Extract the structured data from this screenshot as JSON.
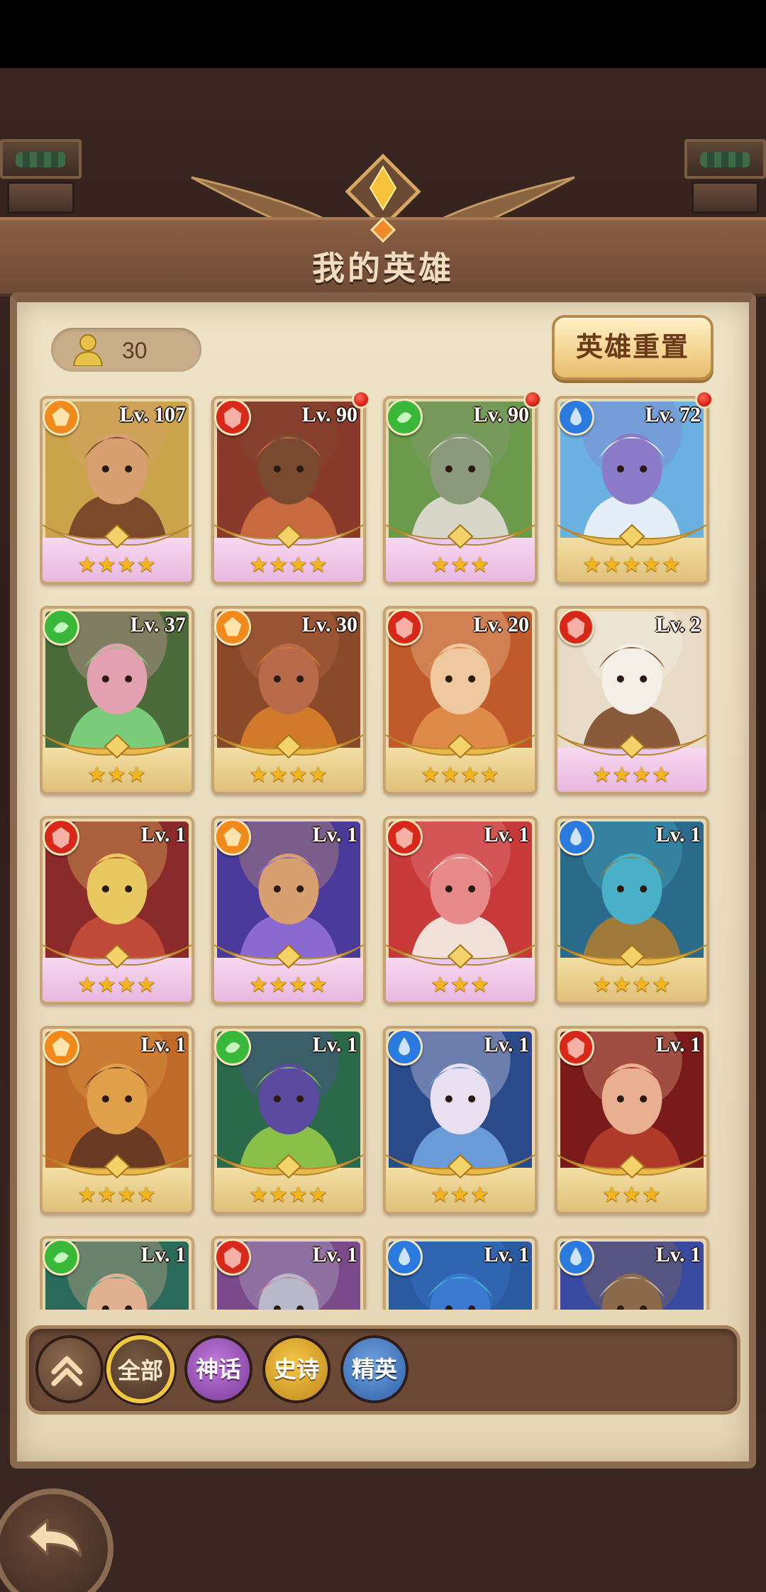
{
  "header": {
    "title": "我的英雄"
  },
  "hero_count": "30",
  "reset_button": "英雄重置",
  "heroes": [
    {
      "level": "Lv. 107",
      "element": "fire-gem",
      "stars": "★★★★",
      "tier": "mythic",
      "alert": false,
      "palette": [
        "#caa34a",
        "#7c4a2a",
        "#d8a070"
      ]
    },
    {
      "level": "Lv. 90",
      "element": "red-gem",
      "stars": "★★★★",
      "tier": "mythic",
      "alert": true,
      "palette": [
        "#8a3a2a",
        "#c86a40",
        "#7a4a30"
      ]
    },
    {
      "level": "Lv. 90",
      "element": "green-gem",
      "stars": "★★★",
      "tier": "mythic",
      "alert": true,
      "palette": [
        "#6a9a4a",
        "#d8d6c8",
        "#8a9a7a"
      ]
    },
    {
      "level": "Lv. 72",
      "element": "water-gem",
      "stars": "★★★★★",
      "tier": "gold",
      "alert": true,
      "palette": [
        "#6ab0e0",
        "#e4eef8",
        "#8a7ac8"
      ]
    },
    {
      "level": "Lv. 37",
      "element": "green-gem",
      "stars": "★★★",
      "tier": "gold",
      "alert": false,
      "palette": [
        "#4a6a3a",
        "#7acc7a",
        "#e2a0b0"
      ]
    },
    {
      "level": "Lv. 30",
      "element": "fire-gem",
      "stars": "★★★★",
      "tier": "gold",
      "alert": false,
      "palette": [
        "#8a4a2a",
        "#d07a2a",
        "#b86a4a"
      ]
    },
    {
      "level": "Lv. 20",
      "element": "red-gem",
      "stars": "★★★★",
      "tier": "gold",
      "alert": false,
      "palette": [
        "#c05a2a",
        "#e08a4a",
        "#f0c8a0"
      ]
    },
    {
      "level": "Lv. 2",
      "element": "red-gem",
      "stars": "★★★★",
      "tier": "mythic",
      "alert": false,
      "palette": [
        "#e8dcc8",
        "#8a5a3a",
        "#f4f0e8"
      ]
    },
    {
      "level": "Lv. 1",
      "element": "red-gem",
      "stars": "★★★★",
      "tier": "mythic",
      "alert": false,
      "palette": [
        "#8a2a2a",
        "#c04a3a",
        "#e8c860"
      ]
    },
    {
      "level": "Lv. 1",
      "element": "fire-gem",
      "stars": "★★★★",
      "tier": "mythic",
      "alert": false,
      "palette": [
        "#4a3a9a",
        "#8a6ad0",
        "#d8a070"
      ]
    },
    {
      "level": "Lv. 1",
      "element": "red-gem",
      "stars": "★★★",
      "tier": "mythic",
      "alert": false,
      "palette": [
        "#c83a3a",
        "#f0e0d8",
        "#e88a8a"
      ]
    },
    {
      "level": "Lv. 1",
      "element": "water-gem",
      "stars": "★★★★",
      "tier": "gold",
      "alert": false,
      "palette": [
        "#2a6a8a",
        "#a07a3a",
        "#4ab0c8"
      ]
    },
    {
      "level": "Lv. 1",
      "element": "fire-gem",
      "stars": "★★★★",
      "tier": "gold",
      "alert": false,
      "palette": [
        "#c06a2a",
        "#6a3a22",
        "#e0a04a"
      ]
    },
    {
      "level": "Lv. 1",
      "element": "green-gem",
      "stars": "★★★★",
      "tier": "gold",
      "alert": false,
      "palette": [
        "#2a6a4a",
        "#8ac04a",
        "#5a4aa0"
      ]
    },
    {
      "level": "Lv. 1",
      "element": "water-gem",
      "stars": "★★★",
      "tier": "gold",
      "alert": false,
      "palette": [
        "#2a4a8a",
        "#6a9ad8",
        "#e8e0f0"
      ]
    },
    {
      "level": "Lv. 1",
      "element": "red-gem",
      "stars": "★★★",
      "tier": "gold",
      "alert": false,
      "palette": [
        "#7a1a1a",
        "#b03a2a",
        "#e8b090"
      ]
    },
    {
      "level": "Lv. 1",
      "element": "green-gem",
      "stars": "",
      "tier": "gold",
      "alert": false,
      "palette": [
        "#2a6a5a",
        "#4ab08a",
        "#e0b090"
      ]
    },
    {
      "level": "Lv. 1",
      "element": "red-gem",
      "stars": "",
      "tier": "gold",
      "alert": false,
      "palette": [
        "#7a4a8a",
        "#d07aa0",
        "#b8b8c8"
      ]
    },
    {
      "level": "Lv. 1",
      "element": "water-gem",
      "stars": "",
      "tier": "gold",
      "alert": false,
      "palette": [
        "#2a5aa0",
        "#4ab8c8",
        "#3a7ad0"
      ]
    },
    {
      "level": "Lv. 1",
      "element": "water-gem",
      "stars": "",
      "tier": "gold",
      "alert": false,
      "palette": [
        "#3a4aa0",
        "#c8b8a8",
        "#8a6a4a"
      ]
    }
  ],
  "filters": {
    "all": "全部",
    "mythic": "神话",
    "epic": "史诗",
    "elite": "精英"
  },
  "colors": {
    "fire-gem": "#f08a1a",
    "red-gem": "#d8281a",
    "green-gem": "#3ab83a",
    "water-gem": "#2a7ae0"
  }
}
